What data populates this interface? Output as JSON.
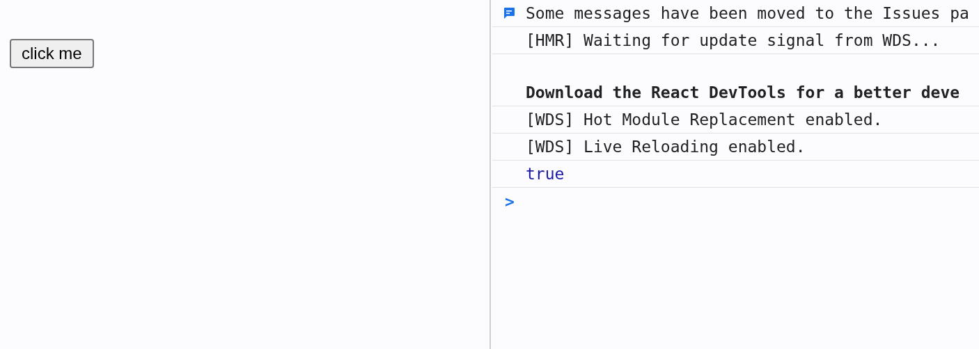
{
  "page": {
    "button": "click me"
  },
  "console": {
    "messages": [
      {
        "kind": "info",
        "text": "Some messages have been moved to the Issues pa"
      },
      {
        "kind": "log",
        "text": "[HMR] Waiting for update signal from WDS..."
      },
      {
        "kind": "bold",
        "text": "Download the React DevTools for a better deve"
      },
      {
        "kind": "log",
        "text": "[WDS] Hot Module Replacement enabled."
      },
      {
        "kind": "log",
        "text": "[WDS] Live Reloading enabled."
      },
      {
        "kind": "result",
        "text": "true"
      }
    ],
    "prompt": ">"
  }
}
